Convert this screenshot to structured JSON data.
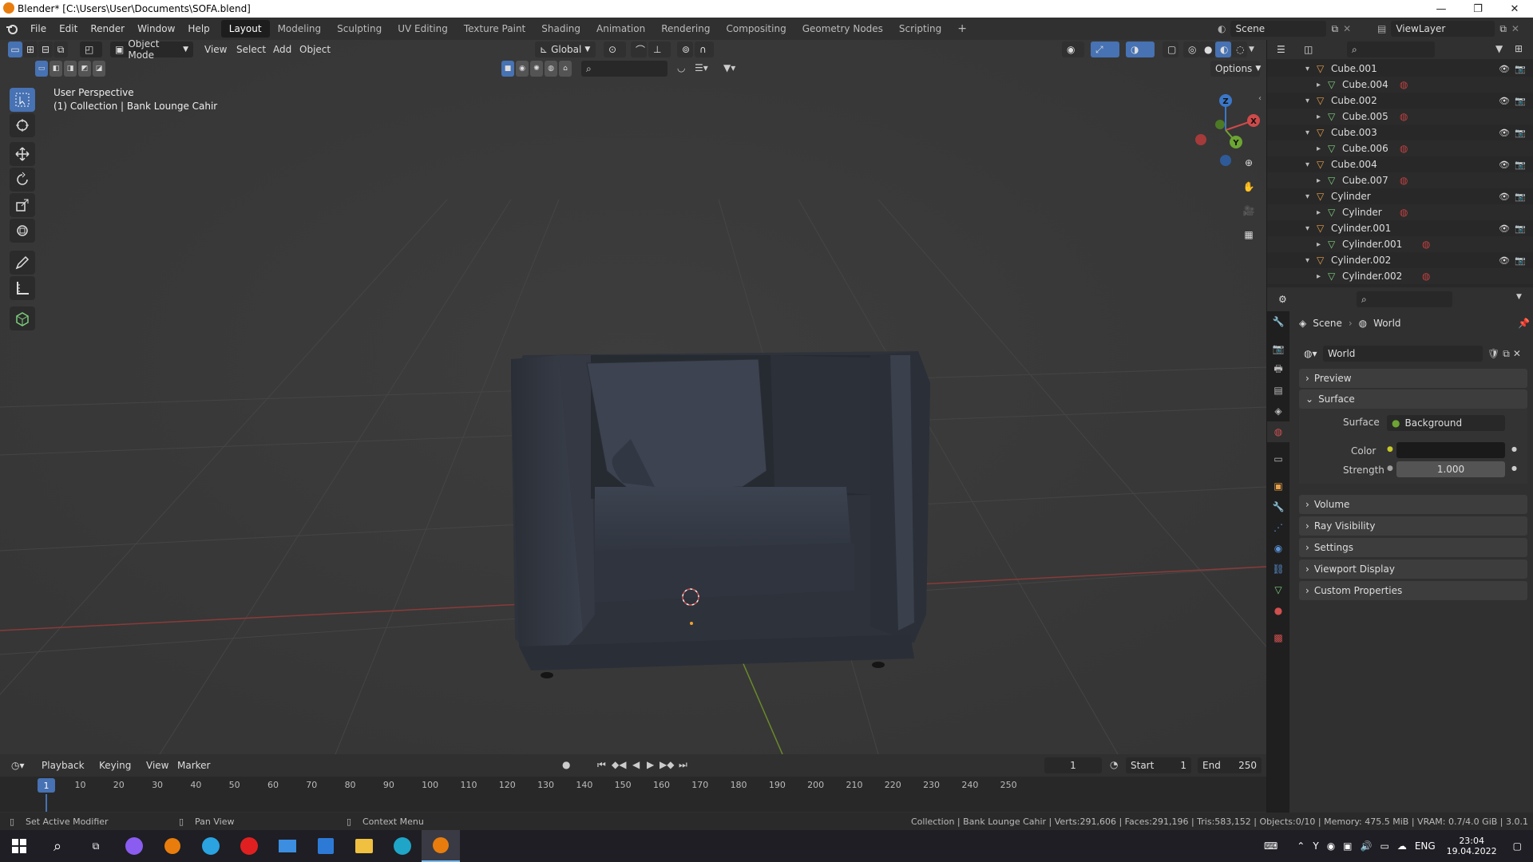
{
  "window": {
    "title": "Blender* [C:\\Users\\User\\Documents\\SOFA.blend]",
    "controls": [
      "—",
      "❐",
      "✕"
    ]
  },
  "menu": [
    "File",
    "Edit",
    "Render",
    "Window",
    "Help"
  ],
  "workspaces": [
    "Layout",
    "Modeling",
    "Sculpting",
    "UV Editing",
    "Texture Paint",
    "Shading",
    "Animation",
    "Rendering",
    "Compositing",
    "Geometry Nodes",
    "Scripting"
  ],
  "active_workspace": "Layout",
  "scene": {
    "label": "Scene",
    "viewlayer": "ViewLayer"
  },
  "viewport_header": {
    "mode": "Object Mode",
    "menus": [
      "View",
      "Select",
      "Add",
      "Object"
    ],
    "transform": "Global",
    "options": "Options"
  },
  "viewport": {
    "perspective": "User Perspective",
    "collection": "(1) Collection | Bank Lounge Cahir",
    "gizmo_axes": {
      "z": "Z",
      "x": "X",
      "y": "Y"
    }
  },
  "outliner": {
    "rows": [
      {
        "name": "Cube.001",
        "type": "object",
        "indent": 1
      },
      {
        "name": "Cube.004",
        "type": "mesh",
        "indent": 2
      },
      {
        "name": "Cube.002",
        "type": "object",
        "indent": 1
      },
      {
        "name": "Cube.005",
        "type": "mesh",
        "indent": 2
      },
      {
        "name": "Cube.003",
        "type": "object",
        "indent": 1
      },
      {
        "name": "Cube.006",
        "type": "mesh",
        "indent": 2
      },
      {
        "name": "Cube.004",
        "type": "object",
        "indent": 1
      },
      {
        "name": "Cube.007",
        "type": "mesh",
        "indent": 2
      },
      {
        "name": "Cylinder",
        "type": "object",
        "indent": 1
      },
      {
        "name": "Cylinder",
        "type": "mesh",
        "indent": 2
      },
      {
        "name": "Cylinder.001",
        "type": "object",
        "indent": 1
      },
      {
        "name": "Cylinder.001",
        "type": "mesh",
        "indent": 2
      },
      {
        "name": "Cylinder.002",
        "type": "object",
        "indent": 1
      },
      {
        "name": "Cylinder.002",
        "type": "mesh",
        "indent": 2
      }
    ]
  },
  "properties": {
    "breadcrumb": [
      "Scene",
      "World"
    ],
    "world_name": "World",
    "panels": {
      "preview": "Preview",
      "surface": "Surface",
      "volume": "Volume",
      "ray_visibility": "Ray Visibility",
      "settings": "Settings",
      "viewport_display": "Viewport Display",
      "custom_properties": "Custom Properties"
    },
    "surface_label": "Surface",
    "surface_value": "Background",
    "color_label": "Color",
    "color_value": "#1a1a1a",
    "strength_label": "Strength",
    "strength_value": "1.000"
  },
  "timeline": {
    "menus": [
      "Playback",
      "Keying",
      "View",
      "Marker"
    ],
    "current_frame": "1",
    "start_label": "Start",
    "start_value": "1",
    "end_label": "End",
    "end_value": "250",
    "ruler_marks": [
      "1",
      "10",
      "20",
      "30",
      "40",
      "50",
      "60",
      "70",
      "80",
      "90",
      "100",
      "110",
      "120",
      "130",
      "140",
      "150",
      "160",
      "170",
      "180",
      "190",
      "200",
      "210",
      "220",
      "230",
      "240",
      "250"
    ]
  },
  "statusbar": {
    "left1": "Set Active Modifier",
    "left2": "Pan View",
    "left3": "Context Menu",
    "right": "Collection | Bank Lounge Cahir | Verts:291,606 | Faces:291,196 | Tris:583,152 | Objects:0/10 | Memory: 475.5 MiB | VRAM: 0.7/4.0 GiB | 3.0.1"
  },
  "taskbar": {
    "lang": "ENG",
    "time": "23:04",
    "date": "19.04.2022"
  },
  "colors": {
    "accent": "#4772b3",
    "object_icon": "#e8a04a",
    "mesh_icon": "#7ed07e",
    "material_icon": "#c04040"
  }
}
